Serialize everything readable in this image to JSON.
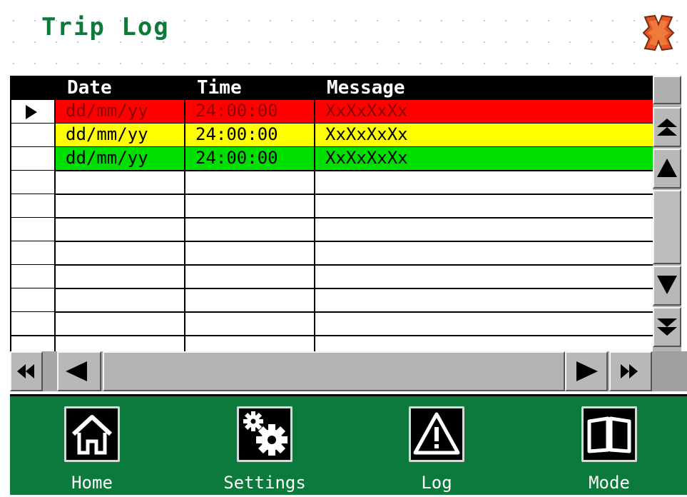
{
  "title": "Trip Log",
  "close_icon": "close-x-icon",
  "columns": [
    "Date",
    "Time",
    "Message"
  ],
  "rows": [
    {
      "date": "dd/mm/yy",
      "time": "24:00:00",
      "message": "XxXxXxXx",
      "bg": "#ff0000",
      "fg": "#8b0000",
      "selected": true
    },
    {
      "date": "dd/mm/yy",
      "time": "24:00:00",
      "message": "XxXxXxXx",
      "bg": "#ffff00",
      "fg": "#000000",
      "selected": false
    },
    {
      "date": "dd/mm/yy",
      "time": "24:00:00",
      "message": "XxXxXxXx",
      "bg": "#00e000",
      "fg": "#000000",
      "selected": false
    }
  ],
  "empty_rows": 7,
  "nav": [
    {
      "label": "Home",
      "icon": "home-icon"
    },
    {
      "label": "Settings",
      "icon": "gears-icon"
    },
    {
      "label": "Log",
      "icon": "warning-icon"
    },
    {
      "label": "Mode",
      "icon": "book-icon"
    }
  ],
  "colors": {
    "title": "#0e7a3a",
    "navbar": "#0b7a3c"
  }
}
